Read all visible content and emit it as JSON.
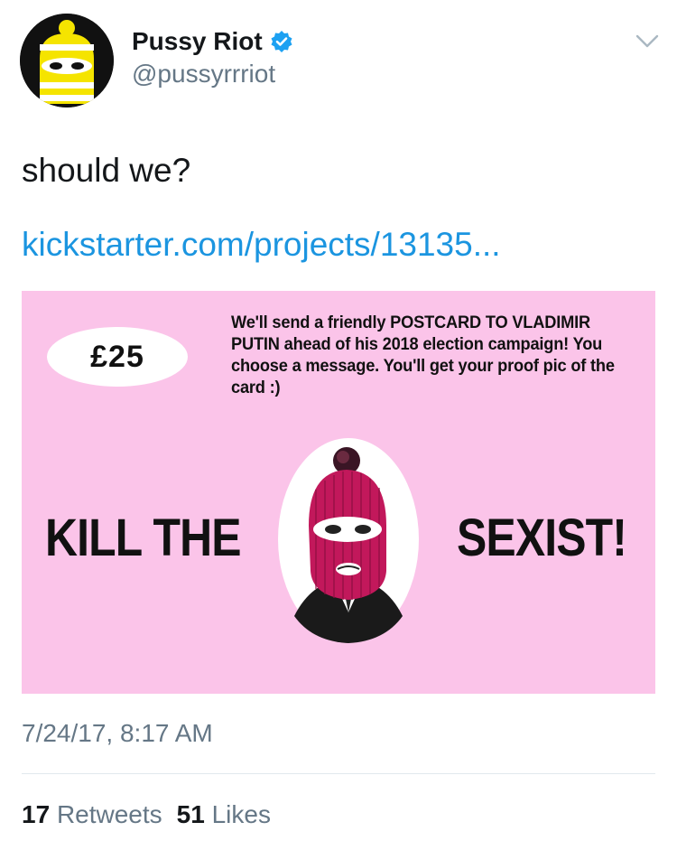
{
  "author": {
    "display_name": "Pussy Riot",
    "handle": "@pussyrrriot",
    "verified": true,
    "avatar_icon": "balaclava-avatar-icon"
  },
  "tweet": {
    "text": "should we?",
    "link_text": "kickstarter.com/projects/13135..."
  },
  "card": {
    "background_color": "#fbc4e9",
    "price": "£25",
    "promo_text": "We'll send a friendly POSTCARD TO VLADIMIR PUTIN ahead of his 2018 election campaign! You choose a message. You'll get your proof pic of the card :)",
    "slogan_left": "KILL THE",
    "slogan_right": "SEXIST!"
  },
  "timestamp": "7/24/17, 8:17 AM",
  "stats": {
    "retweets_count": "17",
    "retweets_label": "Retweets",
    "likes_count": "51",
    "likes_label": "Likes"
  },
  "colors": {
    "link": "#1b95e0",
    "secondary_text": "#657786",
    "verified_badge": "#1da1f2"
  }
}
